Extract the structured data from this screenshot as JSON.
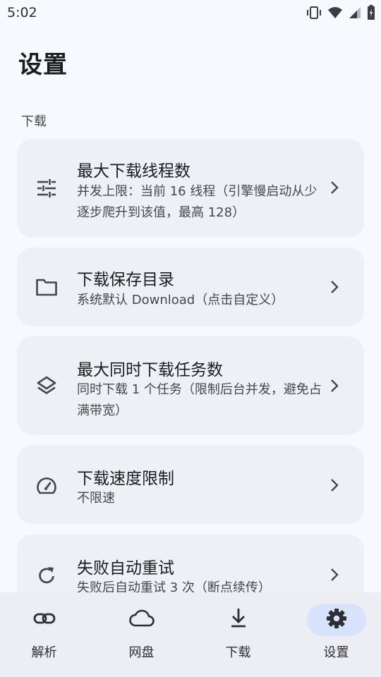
{
  "status_bar": {
    "time": "5:02",
    "icons": [
      "vibrate-icon",
      "wifi-icon",
      "signal-icon",
      "battery-icon"
    ]
  },
  "page": {
    "title": "设置",
    "section_label": "下载"
  },
  "settings": [
    {
      "icon": "tune-icon",
      "title": "最大下载线程数",
      "desc": "并发上限：当前 16 线程（引擎慢启动从少逐步爬升到该值，最高 128）"
    },
    {
      "icon": "folder-icon",
      "title": "下载保存目录",
      "desc": "系统默认 Download（点击自定义）"
    },
    {
      "icon": "layers-icon",
      "title": "最大同时下载任务数",
      "desc": "同时下载 1 个任务（限制后台并发，避免占满带宽）"
    },
    {
      "icon": "speed-icon",
      "title": "下载速度限制",
      "desc": "不限速"
    },
    {
      "icon": "retry-icon",
      "title": "失败自动重试",
      "desc": "失败后自动重试 3 次（断点续传）"
    }
  ],
  "bottom_nav": [
    {
      "icon": "link-icon",
      "label": "解析"
    },
    {
      "icon": "cloud-icon",
      "label": "网盘"
    },
    {
      "icon": "download-icon",
      "label": "下载"
    },
    {
      "icon": "gear-icon",
      "label": "设置",
      "active": true
    }
  ],
  "colors": {
    "background": "#f8f9fe",
    "card": "#eef0f5",
    "nav_background": "#eceef4",
    "active_indicator": "#d9e2fb"
  }
}
